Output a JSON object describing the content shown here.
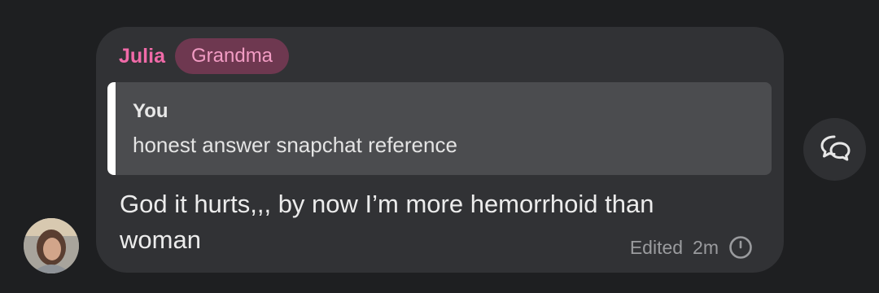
{
  "message": {
    "sender": "Julia",
    "role_badge": "Grandma",
    "quoted": {
      "author": "You",
      "text": "honest answer snapchat reference"
    },
    "body": "God it hurts,,, by now I’m more hemorrhoid than woman",
    "edited_label": "Edited",
    "time": "2m",
    "status_icon": "clock-icon"
  },
  "actions": {
    "thread_icon": "speech-bubbles-icon"
  },
  "colors": {
    "background": "#1e1f21",
    "bubble": "#313235",
    "quote": "#4b4c4f",
    "sender_accent": "#f06aa8",
    "badge_bg": "#6e3850"
  }
}
